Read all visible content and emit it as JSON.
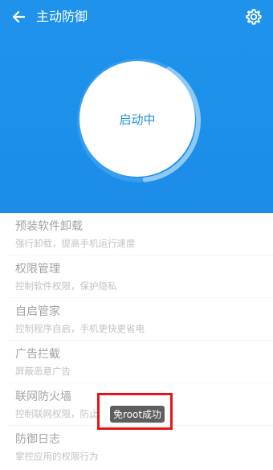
{
  "app": {
    "title": "主动防御",
    "icons": {
      "back": "back-arrow-icon",
      "settings": "gear-icon"
    }
  },
  "status": {
    "text": "启动中",
    "progress": 0.4
  },
  "items": [
    {
      "title": "预装软件卸载",
      "desc": "强行卸载，提高手机运行速度"
    },
    {
      "title": "权限管理",
      "desc": "控制软件权限，保护隐私"
    },
    {
      "title": "自启管家",
      "desc": "控制程序自启，手机更快更省电"
    },
    {
      "title": "广告拦截",
      "desc": "屏蔽恶意广告"
    },
    {
      "title": "联网防火墙",
      "desc": "控制联网权限，防止"
    },
    {
      "title": "防御日志",
      "desc": "掌控应用的权限行为"
    }
  ],
  "toast": {
    "text": "免root成功"
  },
  "colors": {
    "header": "#1f93ec",
    "accent": "#2a8fde",
    "highlight": "#e5151a"
  }
}
